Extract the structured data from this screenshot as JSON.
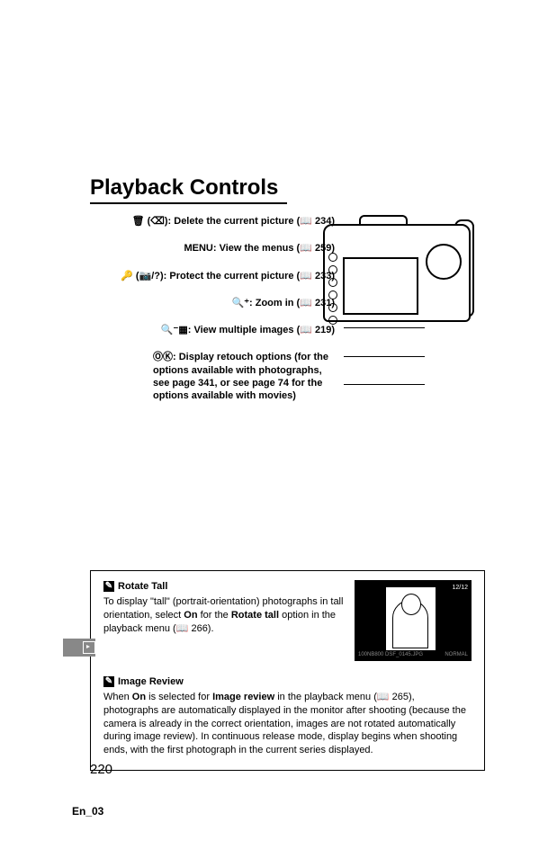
{
  "title": "Playback Controls",
  "controls": {
    "c1": {
      "icon": "🗑 (⌫):",
      "text": "Delete the current picture (📖 234)"
    },
    "c2": {
      "icon": "MENU:",
      "text": "View the menus (📖 259)"
    },
    "c3": {
      "icon": "🔑 (📷/?):",
      "text": "Protect the current picture (📖 233)"
    },
    "c4": {
      "icon": "🔍⁺:",
      "text": "Zoom in (📖 231)"
    },
    "c5": {
      "icon": "🔍⁻▦:",
      "text": "View multiple images (📖 219)"
    },
    "c6": {
      "icon": "ⓄⓀ:",
      "text": "Display retouch options (for the options available with photographs, see page 341, or see page 74 for the options available with movies)"
    }
  },
  "rotate_tall": {
    "heading": "Rotate Tall",
    "body_part1": "To display \"tall\" (portrait-orientation) photographs in tall orientation, select ",
    "on": "On",
    "body_part2": " for the ",
    "opt": "Rotate tall",
    "body_part3": " option in the playback menu (📖 266).",
    "preview_count": "12/12",
    "preview_bl": "100NB800 DSF_0145.JPG",
    "preview_br": "NORMAL"
  },
  "image_review": {
    "heading": "Image Review",
    "p1a": "When ",
    "on": "On",
    "p1b": " is selected for ",
    "opt": "Image review",
    "p1c": " in the playback menu (📖 265), photographs are automatically displayed in the monitor after shooting (because the camera is already in the correct orientation, images are not rotated automatically during image review).  In continuous release mode, display begins when shooting ends, with the first photograph in the current series displayed."
  },
  "page_number": "220",
  "footer": "En_03"
}
